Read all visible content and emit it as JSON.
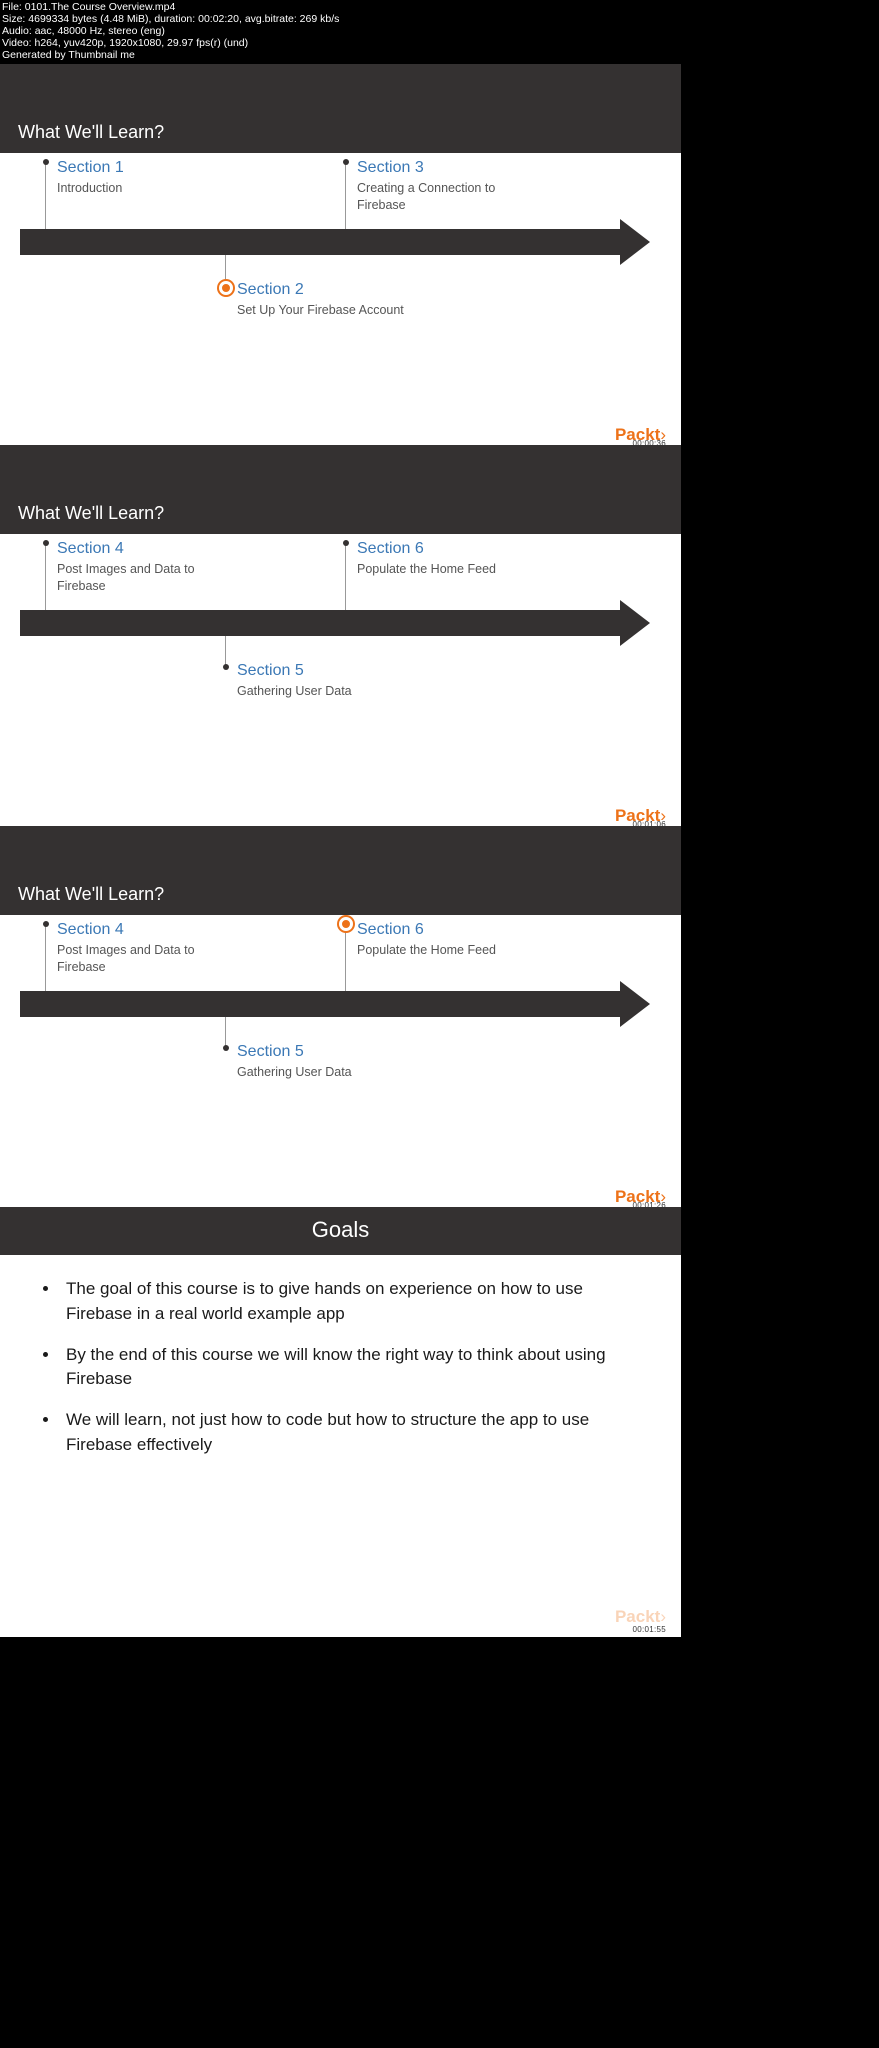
{
  "meta": {
    "l1": "File: 0101.The Course Overview.mp4",
    "l2": "Size: 4699334 bytes (4.48 MiB), duration: 00:02:20, avg.bitrate: 269 kb/s",
    "l3": "Audio: aac, 48000 Hz, stereo (eng)",
    "l4": "Video: h264, yuv420p, 1920x1080, 29.97 fps(r) (und)",
    "l5": "Generated by Thumbnail me"
  },
  "heading": "What We'll Learn?",
  "brand": "Packt",
  "slides": [
    {
      "ts": "00:00:36",
      "highlight": 1,
      "items": [
        {
          "title": "Section 1",
          "desc": "Introduction"
        },
        {
          "title": "Section 2",
          "desc": "Set Up Your Firebase Account"
        },
        {
          "title": "Section 3",
          "desc": "Creating a Connection to Firebase"
        }
      ]
    },
    {
      "ts": "00:01:06",
      "highlight": -1,
      "items": [
        {
          "title": "Section 4",
          "desc": "Post Images and Data to Firebase"
        },
        {
          "title": "Section 5",
          "desc": "Gathering User Data"
        },
        {
          "title": "Section 6",
          "desc": "Populate the Home Feed"
        }
      ]
    },
    {
      "ts": "00:01:26",
      "highlight": 2,
      "items": [
        {
          "title": "Section 4",
          "desc": "Post Images and Data to Firebase"
        },
        {
          "title": "Section 5",
          "desc": "Gathering User Data"
        },
        {
          "title": "Section 6",
          "desc": "Populate the Home Feed"
        }
      ]
    }
  ],
  "goals": {
    "title": "Goals",
    "ts": "00:01:55",
    "items": [
      "The goal of this course is to give hands on experience on how to use Firebase in a real world example app",
      "By the end of this course we will know the right way to think about using Firebase",
      "We will learn, not just how to code but how to structure the app to use Firebase effectively"
    ]
  }
}
